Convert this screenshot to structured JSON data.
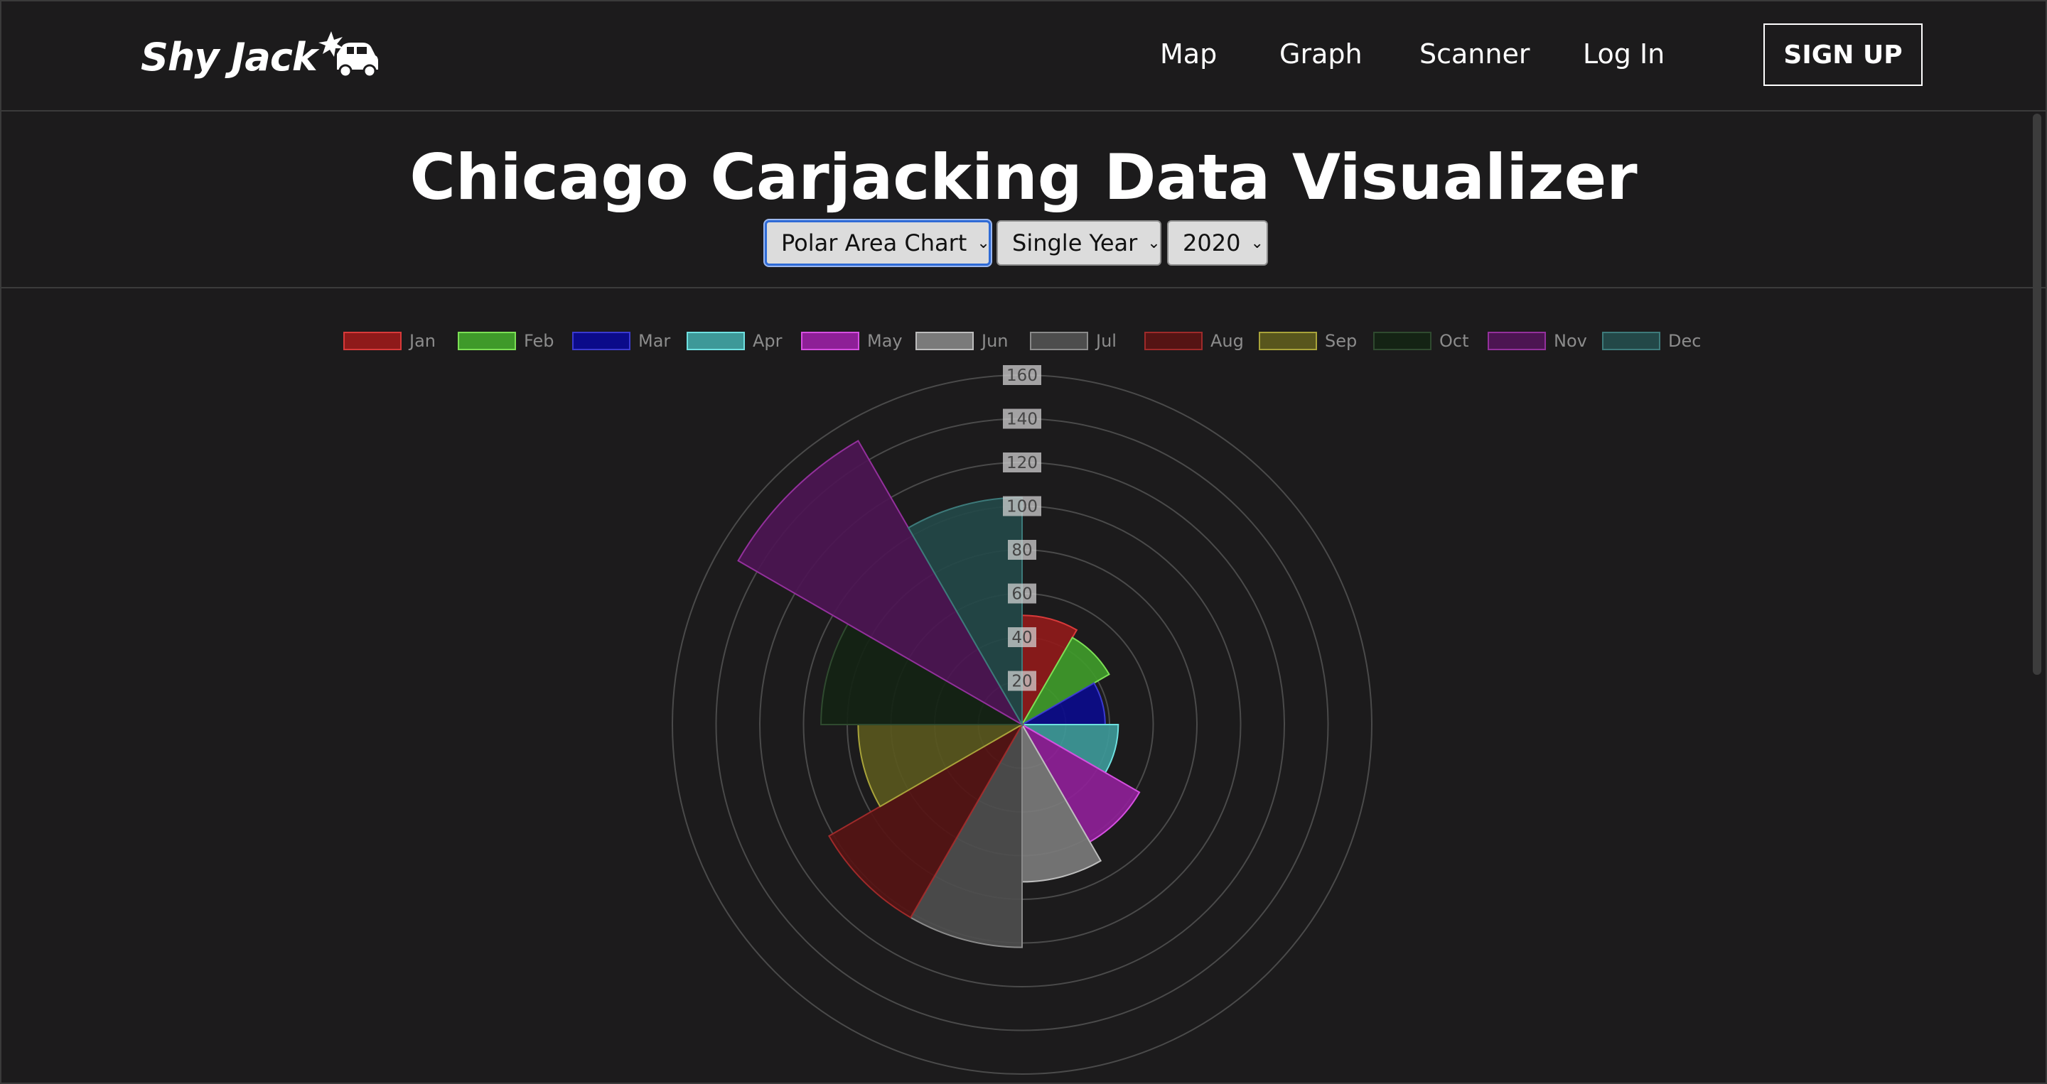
{
  "nav": {
    "logo": "Shy Jack",
    "links": [
      "Map",
      "Graph",
      "Scanner",
      "Log In"
    ],
    "signup": "SIGN UP"
  },
  "page": {
    "title": "Chicago Carjacking Data Visualizer"
  },
  "controls": {
    "chart_type": "Polar Area Chart",
    "range_mode": "Single Year",
    "year": "2020"
  },
  "colors": {
    "background": "#1c1b1c",
    "grid": "#4a4a4a"
  },
  "chart_data": {
    "type": "polar-area",
    "legend_position": "top",
    "categories": [
      "Jan",
      "Feb",
      "Mar",
      "Apr",
      "May",
      "Jun",
      "Jul",
      "Aug",
      "Sep",
      "Oct",
      "Nov",
      "Dec"
    ],
    "values": [
      50,
      46,
      38,
      44,
      62,
      72,
      102,
      102,
      75,
      92,
      150,
      104
    ],
    "colors": [
      {
        "fill": "#8f1a1a",
        "stroke": "#d83a3a"
      },
      {
        "fill": "#3f9a2a",
        "stroke": "#7cdf55"
      },
      {
        "fill": "#0b0b8a",
        "stroke": "#3a3ad0"
      },
      {
        "fill": "#3d9898",
        "stroke": "#6fe0e0"
      },
      {
        "fill": "#8e1f97",
        "stroke": "#d54fe0"
      },
      {
        "fill": "#7a7a7a",
        "stroke": "#bdbdbd"
      },
      {
        "fill": "#4d4d4d",
        "stroke": "#8a8a8a"
      },
      {
        "fill": "#551414",
        "stroke": "#9e2a2a"
      },
      {
        "fill": "#58561d",
        "stroke": "#a8a33a"
      },
      {
        "fill": "#142314",
        "stroke": "#2f4a2f"
      },
      {
        "fill": "#4c1552",
        "stroke": "#93309c"
      },
      {
        "fill": "#234848",
        "stroke": "#3d7a7a"
      }
    ],
    "r_ticks": [
      20,
      40,
      60,
      80,
      100,
      120,
      140,
      160
    ],
    "r_max": 160
  }
}
